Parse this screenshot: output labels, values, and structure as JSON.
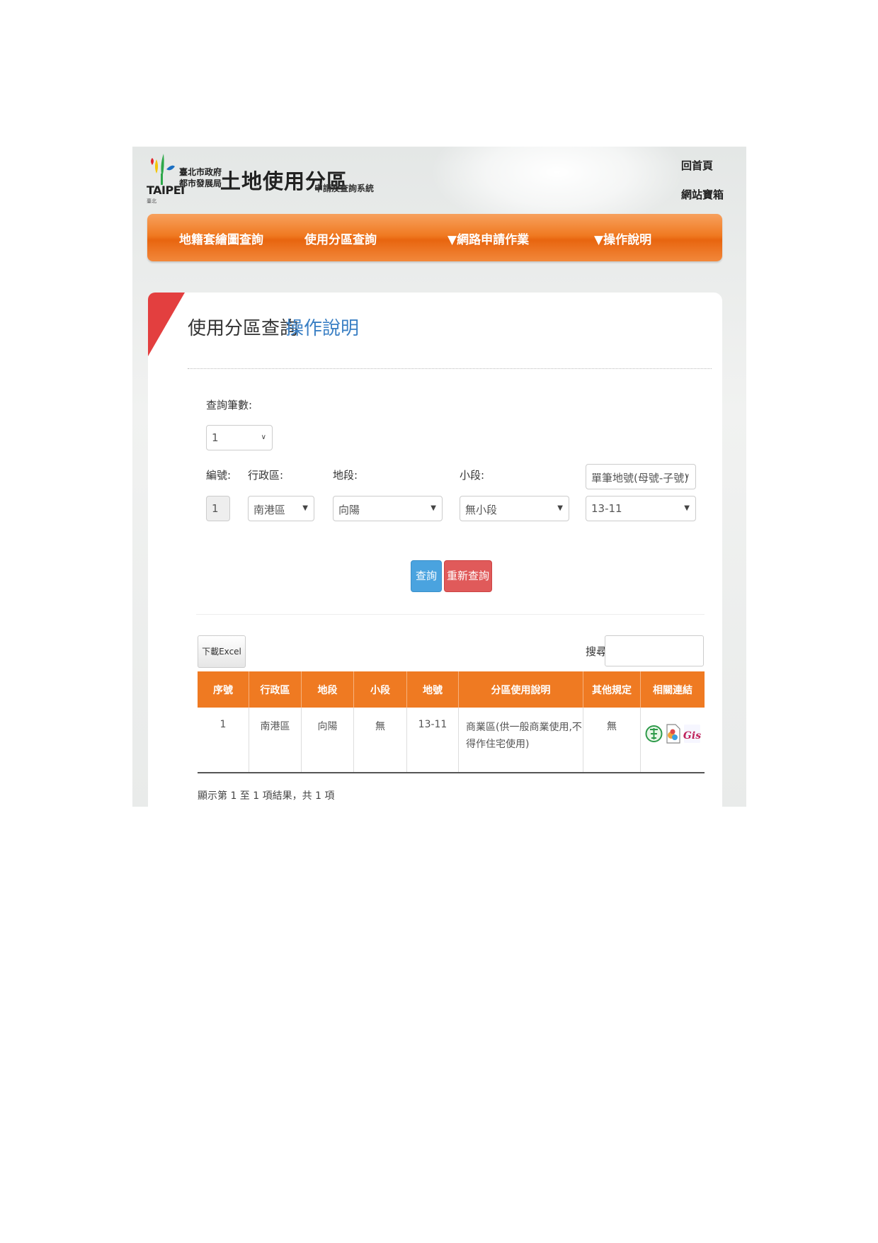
{
  "header": {
    "logo_en": "TAIPEI",
    "logo_small": "臺北",
    "gov_line1": "臺北市政府",
    "gov_line2": "都市發展局",
    "system_title": "土地使用分區",
    "system_subtitle": "申請及查詢系統",
    "link_home": "回首頁",
    "link_sitemap": "網站寶箱"
  },
  "nav": {
    "items": [
      "地籍套繪圖查詢",
      "使用分區查詢",
      "▼網路申請作業",
      "▼操作說明"
    ]
  },
  "page": {
    "title": "使用分區查詢",
    "help_link": "操作說明"
  },
  "form": {
    "count_label": "查詢筆數:",
    "count_value": "1",
    "col_no_label": "編號:",
    "col_district_label": "行政區:",
    "col_section_label": "地段:",
    "col_subsection_label": "小段:",
    "mode_select": "單筆地號(母號-子號)",
    "row_no": "1",
    "district": "南港區",
    "section": "向陽",
    "subsection": "無小段",
    "lot": "13-11",
    "search_button": "查詢",
    "reset_button": "重新查詢"
  },
  "results": {
    "excel_button": "下載Excel",
    "search_label": "搜尋:",
    "search_value": "",
    "columns": [
      "序號",
      "行政區",
      "地段",
      "小段",
      "地號",
      "分區使用說明",
      "其他規定",
      "相關連結"
    ],
    "rows": [
      {
        "no": "1",
        "district": "南港區",
        "section": "向陽",
        "subsection": "無",
        "lot": "13-11",
        "desc": "商業區(供一般商業使用,不得作住宅使用)",
        "other": "無"
      }
    ],
    "icons": [
      "gov-emblem-icon",
      "document-icon",
      "gis-icon"
    ],
    "info": "顯示第 1 至 1 項結果，共 1 項"
  },
  "colors": {
    "nav_orange": "#ef7a22",
    "title_blue": "#3a7fc4",
    "ribbon_red": "#e33f3f",
    "button_blue": "#4aa3df",
    "button_red": "#e05a5a"
  }
}
